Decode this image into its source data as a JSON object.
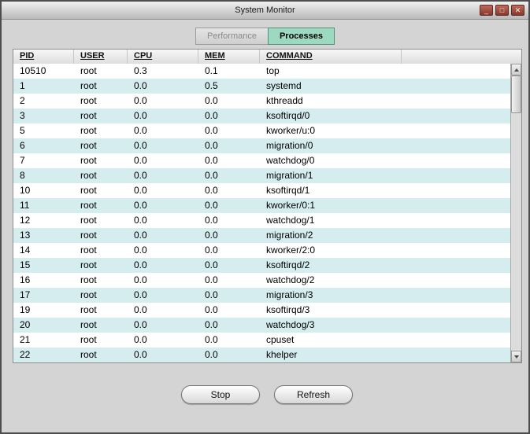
{
  "window": {
    "title": "System Monitor",
    "controls": {
      "minimize": "_",
      "maximize": "□",
      "close": "✕"
    }
  },
  "tabs": {
    "performance": "Performance",
    "processes": "Processes"
  },
  "table": {
    "columns": [
      "PID",
      "USER",
      "CPU",
      "MEM",
      "COMMAND"
    ],
    "rows": [
      [
        "10510",
        "root",
        "0.3",
        "0.1",
        "top"
      ],
      [
        "1",
        "root",
        "0.0",
        "0.5",
        "systemd"
      ],
      [
        "2",
        "root",
        "0.0",
        "0.0",
        "kthreadd"
      ],
      [
        "3",
        "root",
        "0.0",
        "0.0",
        "ksoftirqd/0"
      ],
      [
        "5",
        "root",
        "0.0",
        "0.0",
        "kworker/u:0"
      ],
      [
        "6",
        "root",
        "0.0",
        "0.0",
        "migration/0"
      ],
      [
        "7",
        "root",
        "0.0",
        "0.0",
        "watchdog/0"
      ],
      [
        "8",
        "root",
        "0.0",
        "0.0",
        "migration/1"
      ],
      [
        "10",
        "root",
        "0.0",
        "0.0",
        "ksoftirqd/1"
      ],
      [
        "11",
        "root",
        "0.0",
        "0.0",
        "kworker/0:1"
      ],
      [
        "12",
        "root",
        "0.0",
        "0.0",
        "watchdog/1"
      ],
      [
        "13",
        "root",
        "0.0",
        "0.0",
        "migration/2"
      ],
      [
        "14",
        "root",
        "0.0",
        "0.0",
        "kworker/2:0"
      ],
      [
        "15",
        "root",
        "0.0",
        "0.0",
        "ksoftirqd/2"
      ],
      [
        "16",
        "root",
        "0.0",
        "0.0",
        "watchdog/2"
      ],
      [
        "17",
        "root",
        "0.0",
        "0.0",
        "migration/3"
      ],
      [
        "19",
        "root",
        "0.0",
        "0.0",
        "ksoftirqd/3"
      ],
      [
        "20",
        "root",
        "0.0",
        "0.0",
        "watchdog/3"
      ],
      [
        "21",
        "root",
        "0.0",
        "0.0",
        "cpuset"
      ],
      [
        "22",
        "root",
        "0.0",
        "0.0",
        "khelper"
      ]
    ]
  },
  "actions": {
    "stop": "Stop",
    "refresh": "Refresh"
  },
  "colors": {
    "active_tab": "#9cd9c0",
    "row_stripe": "#d5edee",
    "window_background": "#d4d4d4",
    "titlebar_button": "#88372c"
  }
}
